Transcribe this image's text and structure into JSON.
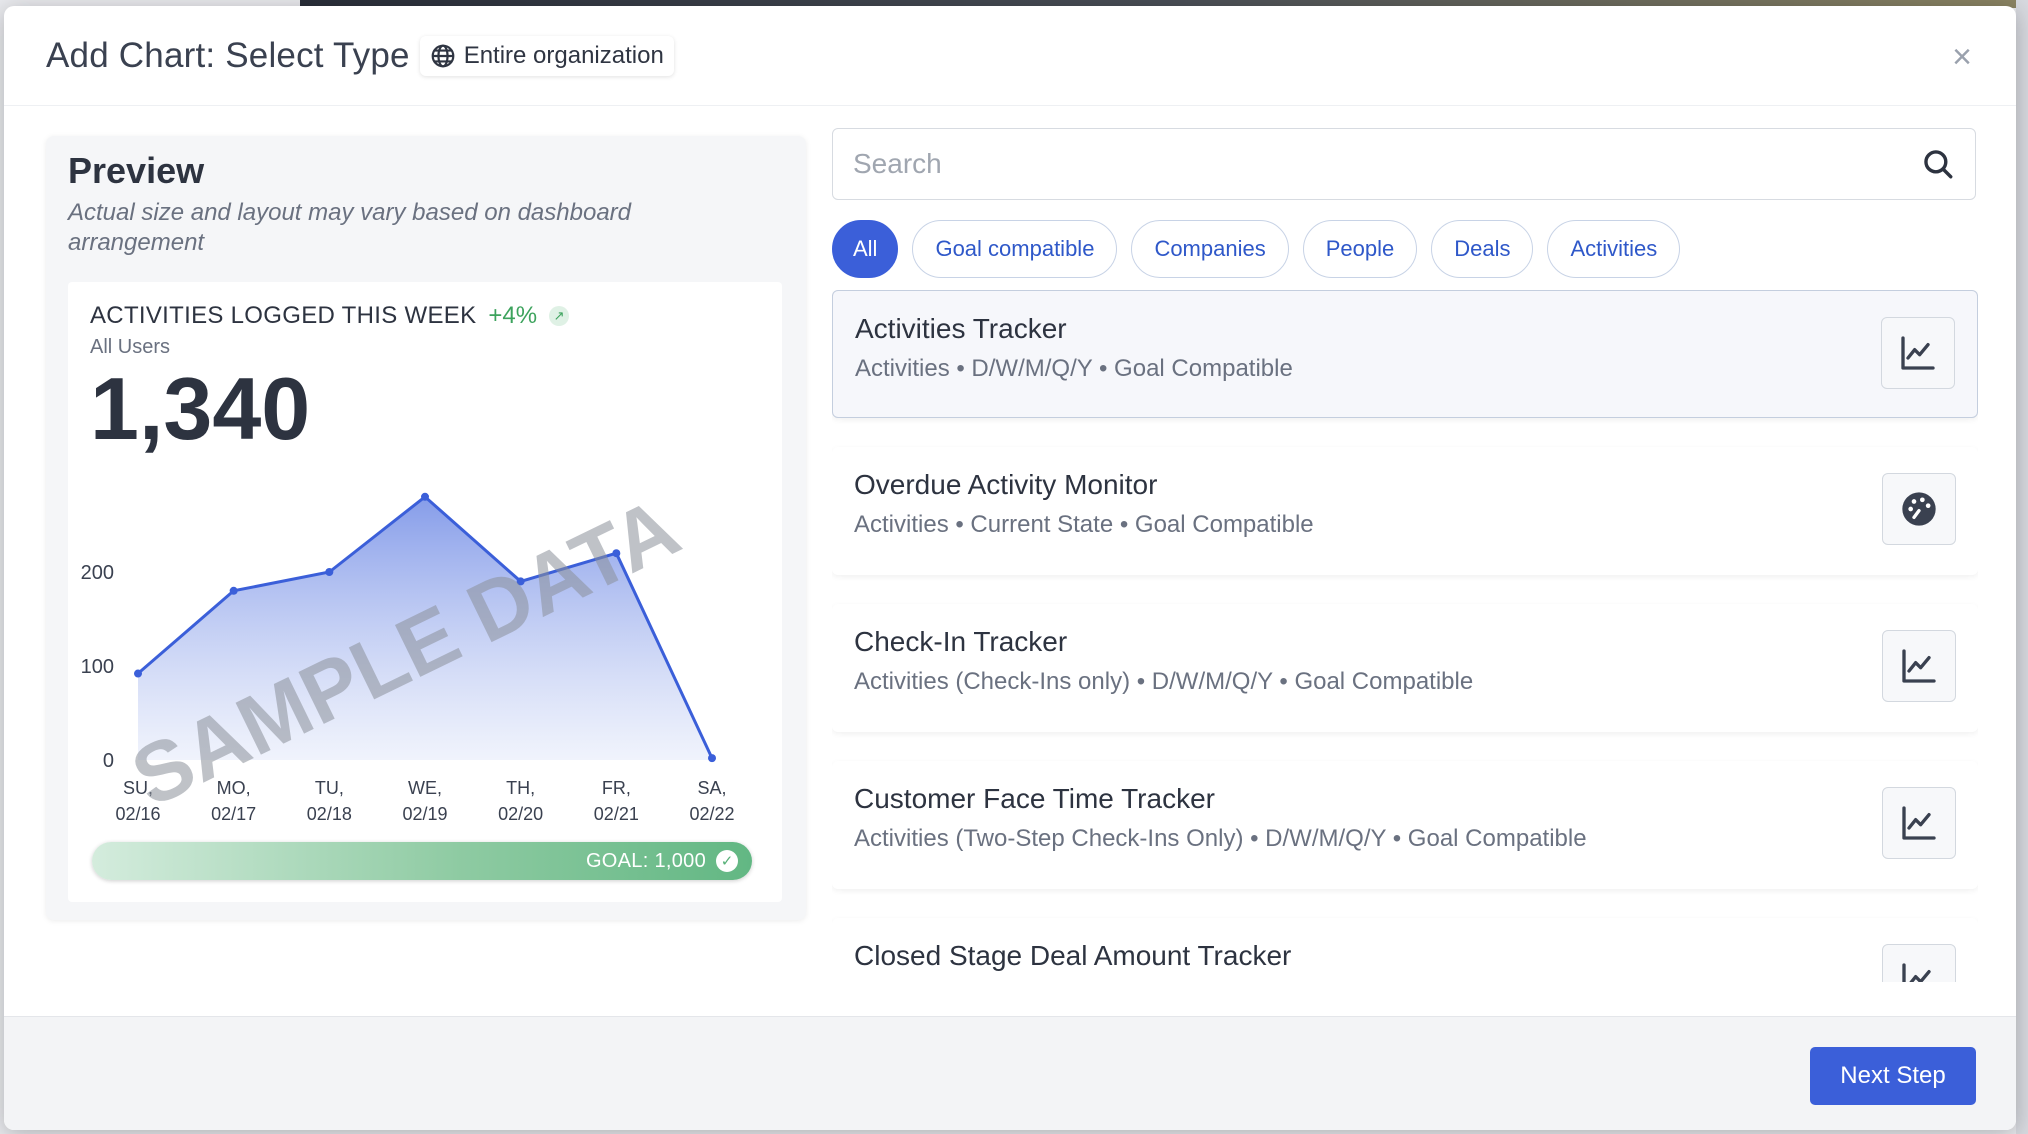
{
  "modal": {
    "title": "Add Chart: Select Type",
    "scope": "Entire organization",
    "close_label": "×"
  },
  "preview": {
    "title": "Preview",
    "subtitle": "Actual size and layout may vary based on dashboard arrangement",
    "card": {
      "title": "ACTIVITIES LOGGED THIS WEEK",
      "delta": "+4%",
      "users": "All Users",
      "value": "1,340",
      "watermark": "SAMPLE DATA",
      "goal_label": "GOAL: 1,000"
    }
  },
  "chart_data": {
    "type": "area",
    "categories": [
      "SU, 02/16",
      "MO, 02/17",
      "TU, 02/18",
      "WE, 02/19",
      "TH, 02/20",
      "FR, 02/21",
      "SA, 02/22"
    ],
    "x_labels_top": [
      "SU,",
      "MO,",
      "TU,",
      "WE,",
      "TH,",
      "FR,",
      "SA,"
    ],
    "x_labels_bottom": [
      "02/16",
      "02/17",
      "02/18",
      "02/19",
      "02/20",
      "02/21",
      "02/22"
    ],
    "values": [
      92,
      180,
      200,
      280,
      190,
      220,
      2
    ],
    "yticks": [
      0,
      100,
      200
    ],
    "ylim": [
      0,
      300
    ],
    "color": "#3b5fd9"
  },
  "search": {
    "placeholder": "Search",
    "value": ""
  },
  "filters": [
    "All",
    "Goal compatible",
    "Companies",
    "People",
    "Deals",
    "Activities"
  ],
  "active_filter": "All",
  "chart_types": [
    {
      "title": "Activities Tracker",
      "desc": "Activities • D/W/M/Q/Y • Goal Compatible",
      "icon": "line-chart-icon"
    },
    {
      "title": "Overdue Activity Monitor",
      "desc": "Activities • Current State • Goal Compatible",
      "icon": "gauge-icon"
    },
    {
      "title": "Check-In Tracker",
      "desc": "Activities (Check-Ins only) • D/W/M/Q/Y • Goal Compatible",
      "icon": "line-chart-icon"
    },
    {
      "title": "Customer Face Time Tracker",
      "desc": "Activities (Two-Step Check-Ins Only) • D/W/M/Q/Y • Goal Compatible",
      "icon": "line-chart-icon"
    },
    {
      "title": "Closed Stage Deal Amount Tracker",
      "desc": "",
      "icon": "line-chart-icon"
    }
  ],
  "footer": {
    "next_label": "Next Step"
  }
}
